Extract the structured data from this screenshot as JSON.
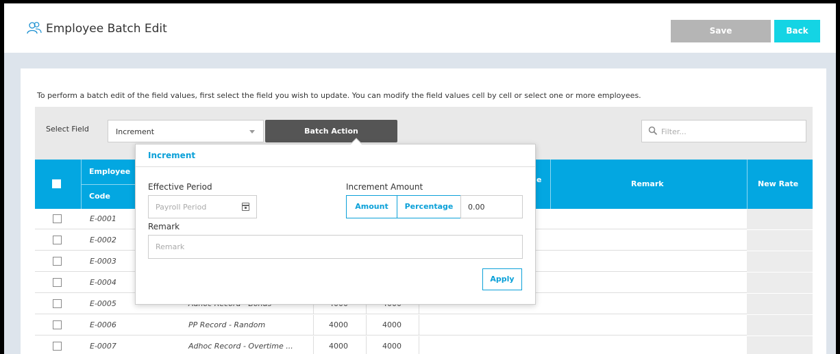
{
  "header": {
    "title": "Employee Batch Edit",
    "title_icon": "users-icon",
    "save_label": "Save",
    "back_label": "Back",
    "colors": {
      "save": "#b5b5b5",
      "back": "#14d4e4"
    }
  },
  "instructions": "To perform a batch edit of the field values, first select the field you wish to update. You can modify the field values cell by cell or select one or more employees.",
  "toolbar": {
    "select_label": "Select Field",
    "select_value": "Increment",
    "batch_action_label": "Batch Action",
    "filter_placeholder": "Filter..."
  },
  "table": {
    "headers": {
      "employee": "Employee",
      "code": "Code",
      "remark": "Remark",
      "new_rate": "New Rate",
      "partial": "e"
    },
    "rows": [
      {
        "code": "E-0001",
        "name": "",
        "v1": "",
        "v2": ""
      },
      {
        "code": "E-0002",
        "name": "",
        "v1": "",
        "v2": ""
      },
      {
        "code": "E-0003",
        "name": "",
        "v1": "",
        "v2": ""
      },
      {
        "code": "E-0004",
        "name": "",
        "v1": "",
        "v2": ""
      },
      {
        "code": "E-0005",
        "name": "Adhoc Record - Bonus",
        "v1": "4000",
        "v2": "4000"
      },
      {
        "code": "E-0006",
        "name": "PP Record - Random",
        "v1": "4000",
        "v2": "4000"
      },
      {
        "code": "E-0007",
        "name": "Adhoc Record - Overtime ...",
        "v1": "4000",
        "v2": "4000"
      }
    ],
    "header_color": "#03a7e1"
  },
  "popup": {
    "title": "Increment",
    "effective_period_label": "Effective Period",
    "effective_period_placeholder": "Payroll Period",
    "increment_amount_label": "Increment Amount",
    "amount_label": "Amount",
    "percentage_label": "Percentage",
    "amount_value": "0.00",
    "remark_label": "Remark",
    "remark_placeholder": "Remark",
    "apply_label": "Apply",
    "accent": "#0aa0d8"
  }
}
